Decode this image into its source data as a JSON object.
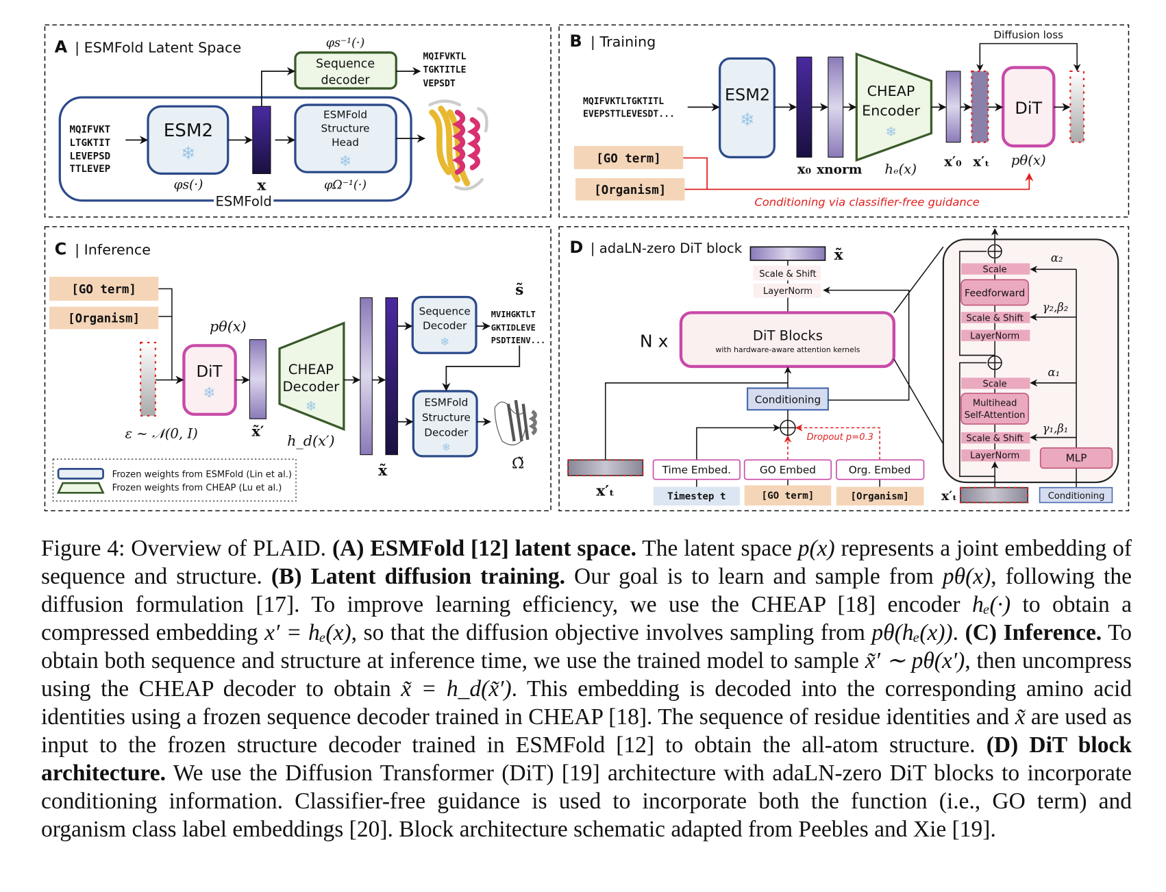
{
  "colors": {
    "esm_blue": "#2c4a8a",
    "cheap_green": "#3a5a2a",
    "dit_pink": "#c84aa8",
    "cond_red": "#e02020",
    "seq_orange": "#b8742a",
    "seq_magenta": "#a0306a",
    "tag_fill": "#f5d5b8"
  },
  "panelA": {
    "letter": "A",
    "title": "| ESMFold Latent Space",
    "input_seq": [
      "MQIFVKT",
      "LTGKTIT",
      "LEVEPSD",
      "TTLEVEP"
    ],
    "esm2": "ESM2",
    "phi_s": "φs(·)",
    "x": "x",
    "seq_decoder": [
      "Sequence",
      "decoder"
    ],
    "phi_s_inv": "φs⁻¹(·)",
    "output_seq": [
      "MQIFVKTL",
      "TGKTITLE",
      "VEPSDT"
    ],
    "struct_head": [
      "ESMFold",
      "Structure",
      "Head"
    ],
    "phi_omega_inv": "φΩ⁻¹(·)",
    "esmfold": "ESMFold",
    "icons": [
      "snowflake-icon",
      "protein-structure"
    ]
  },
  "panelB": {
    "letter": "B",
    "title": "| Training",
    "input_seq": [
      "MQIFVKTLTGKTITL",
      "EVEPSTTLEVESDT..."
    ],
    "esm2": "ESM2",
    "cheap": [
      "CHEAP",
      "Encoder"
    ],
    "dit": "DiT",
    "diffusion_loss": "Diffusion loss",
    "x0": "x₀",
    "xnorm": "xnorm",
    "he": "hₑ(x)",
    "x0p": "x′₀",
    "xtp": "x′ₜ",
    "ptheta": "pθ(x)",
    "go": "[GO term]",
    "org": "[Organism]",
    "cond": "Conditioning via classifier-free guidance"
  },
  "panelC": {
    "letter": "C",
    "title": "| Inference",
    "go": "[GO term]",
    "org": "[Organism]",
    "ptheta": "pθ(x)",
    "dit": "DiT",
    "noise": "ε ∼ 𝒩(0, I)",
    "xtp": "x̃′",
    "cheap": [
      "CHEAP",
      "Decoder"
    ],
    "hd": "h_d(x′)",
    "xt": "x̃",
    "seq_decoder": [
      "Sequence",
      "Decoder"
    ],
    "s": "s̃",
    "out_seq": [
      "MVIHGKTLT",
      "GKTIDLEVE",
      "PSDTIENV..."
    ],
    "struct_dec": [
      "ESMFold",
      "Structure",
      "Decoder"
    ],
    "omega": "Ω̃",
    "legend": [
      "Frozen weights from ESMFold (Lin et al.)",
      "Frozen weights from CHEAP (Lu et al.)"
    ]
  },
  "panelD": {
    "letter": "D",
    "title": "| adaLN-zero DiT block",
    "xt": "x̃",
    "scale_shift": "Scale & Shift",
    "layernorm": "LayerNorm",
    "dit_blocks": "DiT Blocks",
    "dit_sub": "with hardware-aware attention kernels",
    "nx": "N x",
    "conditioning": "Conditioning",
    "dropout": "Dropout p=0.3",
    "time_embed": "Time Embed.",
    "go_embed": "GO Embed",
    "org_embed": "Org. Embed",
    "timestep": "Timestep t",
    "go": "[GO term]",
    "org": "[Organism]",
    "xtp": "x′ₜ",
    "block": {
      "scale": "Scale",
      "feedforward": "Feedforward",
      "scale_shift": "Scale & Shift",
      "layernorm": "LayerNorm",
      "mhsa": [
        "Multihead",
        "Self-Attention"
      ],
      "mlp": "MLP",
      "conditioning": "Conditioning",
      "xtp": "x′ₜ",
      "a2": "α₂",
      "gb2": "γ₂,β₂",
      "a1": "α₁",
      "gb1": "γ₁,β₁"
    }
  },
  "caption": [
    {
      "s": "n",
      "t": "Figure 4: Overview of PLAID. "
    },
    {
      "s": "b",
      "t": "(A) ESMFold [12] latent space."
    },
    {
      "s": "n",
      "t": " The latent space "
    },
    {
      "s": "i",
      "t": "p(x)"
    },
    {
      "s": "n",
      "t": " represents a joint embedding of sequence and structure. "
    },
    {
      "s": "b",
      "t": "(B) Latent diffusion training."
    },
    {
      "s": "n",
      "t": " Our goal is to learn and sample from "
    },
    {
      "s": "i",
      "t": "pθ(x)"
    },
    {
      "s": "n",
      "t": ", following the diffusion formulation [17]. To improve learning efficiency, we use the CHEAP [18] encoder "
    },
    {
      "s": "i",
      "t": "hₑ(·)"
    },
    {
      "s": "n",
      "t": " to obtain a compressed embedding "
    },
    {
      "s": "i",
      "t": "x′ = hₑ(x)"
    },
    {
      "s": "n",
      "t": ", so that the diffusion objective involves sampling from "
    },
    {
      "s": "i",
      "t": "pθ(hₑ(x))"
    },
    {
      "s": "n",
      "t": ". "
    },
    {
      "s": "b",
      "t": "(C) Inference."
    },
    {
      "s": "n",
      "t": " To obtain both sequence and structure at inference time, we use the trained model to sample "
    },
    {
      "s": "i",
      "t": "x̃′ ∼ pθ(x′)"
    },
    {
      "s": "n",
      "t": ", then uncompress using the CHEAP decoder to obtain "
    },
    {
      "s": "i",
      "t": "x̃ = h_d(x̃′)"
    },
    {
      "s": "n",
      "t": ". This embedding is decoded into the corresponding amino acid identities using a frozen sequence decoder trained in CHEAP [18]. The sequence of residue identities and "
    },
    {
      "s": "i",
      "t": "x̃"
    },
    {
      "s": "n",
      "t": " are used as input to the frozen structure decoder trained in ESMFold [12] to obtain the all-atom structure. "
    },
    {
      "s": "b",
      "t": "(D) DiT block architecture."
    },
    {
      "s": "n",
      "t": " We use the Diffusion Transformer (DiT) [19] architecture with adaLN-zero DiT blocks to incorporate conditioning information. Classifier-free guidance is used to incorporate both the function (i.e., GO term) and organism class label embeddings [20]. Block architecture schematic adapted from Peebles and Xie [19]."
    }
  ]
}
